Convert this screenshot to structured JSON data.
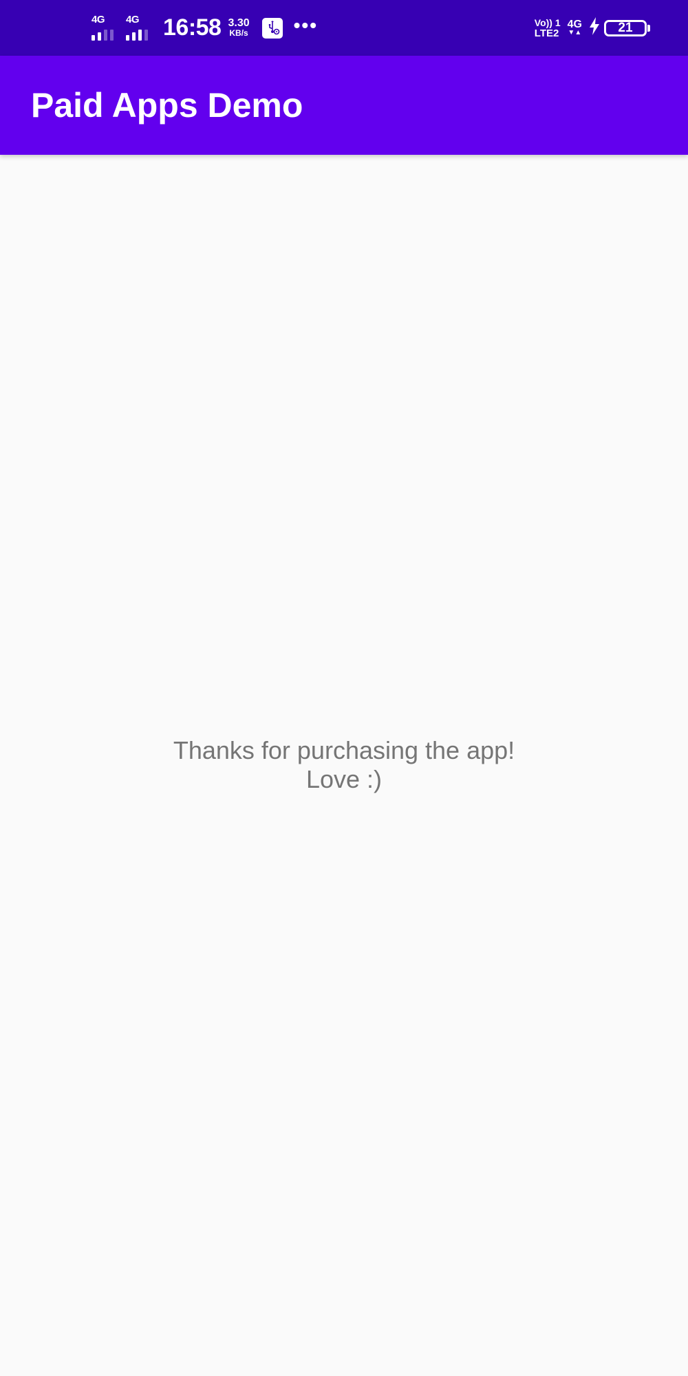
{
  "status_bar": {
    "sim1_network": "4G",
    "sim2_network": "4G",
    "time": "16:58",
    "net_speed_value": "3.30",
    "net_speed_unit": "KB/s",
    "notification_icons": [
      "usb-debug-icon",
      "more-dots-icon"
    ],
    "more_indicator": "•••",
    "volte_line1": "Vo)) 1",
    "volte_line2": "LTE2",
    "data_network": "4G",
    "data_arrows": "▼▲",
    "battery_level": "21",
    "charging": true
  },
  "app_bar": {
    "title": "Paid Apps Demo",
    "color": "#6200ee"
  },
  "main": {
    "message": "Thanks for purchasing the app!\nLove :)"
  },
  "colors": {
    "status_bar": "#3700b3",
    "app_bar": "#6200ee",
    "background": "#fafafa",
    "message_text": "#757575"
  }
}
